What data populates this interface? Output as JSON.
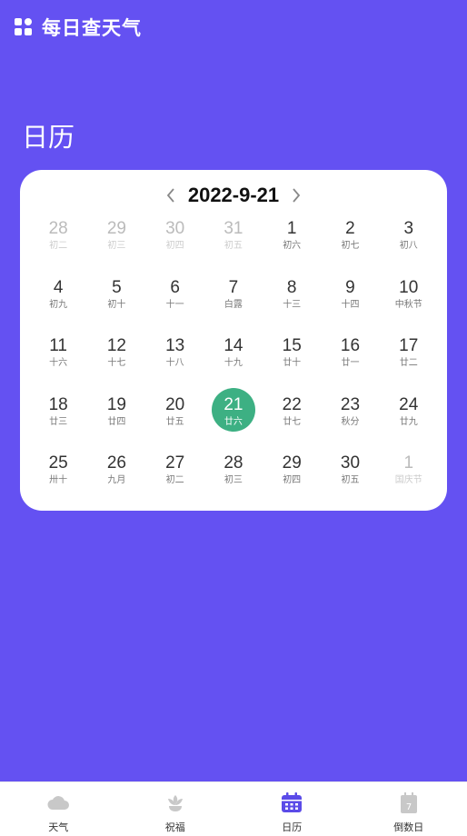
{
  "app": {
    "title": "每日查天气"
  },
  "page": {
    "title": "日历"
  },
  "calendar": {
    "current_date": "2022-9-21",
    "days": [
      {
        "num": "28",
        "lunar": "初二",
        "other": true
      },
      {
        "num": "29",
        "lunar": "初三",
        "other": true
      },
      {
        "num": "30",
        "lunar": "初四",
        "other": true
      },
      {
        "num": "31",
        "lunar": "初五",
        "other": true
      },
      {
        "num": "1",
        "lunar": "初六"
      },
      {
        "num": "2",
        "lunar": "初七"
      },
      {
        "num": "3",
        "lunar": "初八"
      },
      {
        "num": "4",
        "lunar": "初九"
      },
      {
        "num": "5",
        "lunar": "初十"
      },
      {
        "num": "6",
        "lunar": "十一"
      },
      {
        "num": "7",
        "lunar": "白露"
      },
      {
        "num": "8",
        "lunar": "十三"
      },
      {
        "num": "9",
        "lunar": "十四"
      },
      {
        "num": "10",
        "lunar": "中秋节"
      },
      {
        "num": "11",
        "lunar": "十六"
      },
      {
        "num": "12",
        "lunar": "十七"
      },
      {
        "num": "13",
        "lunar": "十八"
      },
      {
        "num": "14",
        "lunar": "十九"
      },
      {
        "num": "15",
        "lunar": "廿十"
      },
      {
        "num": "16",
        "lunar": "廿一"
      },
      {
        "num": "17",
        "lunar": "廿二"
      },
      {
        "num": "18",
        "lunar": "廿三"
      },
      {
        "num": "19",
        "lunar": "廿四"
      },
      {
        "num": "20",
        "lunar": "廿五"
      },
      {
        "num": "21",
        "lunar": "廿六",
        "selected": true
      },
      {
        "num": "22",
        "lunar": "廿七"
      },
      {
        "num": "23",
        "lunar": "秋分"
      },
      {
        "num": "24",
        "lunar": "廿九"
      },
      {
        "num": "25",
        "lunar": "卅十"
      },
      {
        "num": "26",
        "lunar": "九月"
      },
      {
        "num": "27",
        "lunar": "初二"
      },
      {
        "num": "28",
        "lunar": "初三"
      },
      {
        "num": "29",
        "lunar": "初四"
      },
      {
        "num": "30",
        "lunar": "初五"
      },
      {
        "num": "1",
        "lunar": "国庆节",
        "other": true
      }
    ]
  },
  "tabs": [
    {
      "label": "天气",
      "icon": "cloud-icon"
    },
    {
      "label": "祝福",
      "icon": "flower-icon"
    },
    {
      "label": "日历",
      "icon": "calendar-icon",
      "active": true
    },
    {
      "label": "倒数日",
      "icon": "countdown-icon"
    }
  ],
  "colors": {
    "background": "#6451F2",
    "selected": "#3DB083",
    "tab_active": "#5B4BE8",
    "tab_inactive": "#C8C8C8"
  }
}
